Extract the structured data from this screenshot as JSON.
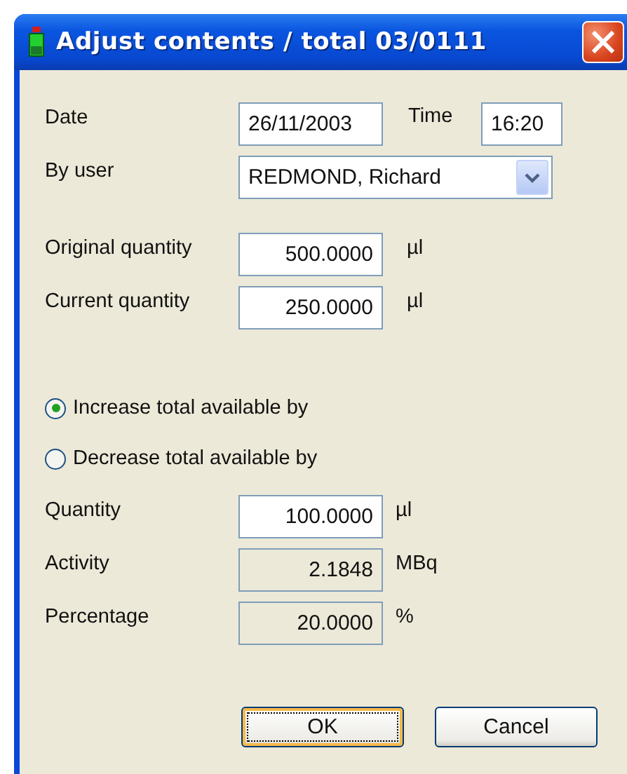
{
  "window": {
    "title": "Adjust contents / total 03/0111"
  },
  "date": {
    "label": "Date",
    "value": "26/11/2003"
  },
  "time": {
    "label": "Time",
    "value": "16:20"
  },
  "user": {
    "label": "By user",
    "value": "REDMOND, Richard"
  },
  "quantities": [
    {
      "label": "Original quantity",
      "value": "500.0000",
      "unit": "µl",
      "readonly": false
    },
    {
      "label": "Current quantity",
      "value": "250.0000",
      "unit": "µl",
      "readonly": false
    }
  ],
  "adjustment": [
    {
      "label": "Increase total available by",
      "selected": true
    },
    {
      "label": "Decrease total available by",
      "selected": false
    }
  ],
  "amounts": [
    {
      "label": "Quantity",
      "value": "100.0000",
      "unit": "µl",
      "readonly": false
    },
    {
      "label": "Activity",
      "value": "2.1848",
      "unit": "MBq",
      "readonly": true
    },
    {
      "label": "Percentage",
      "value": "20.0000",
      "unit": "%",
      "readonly": true
    }
  ],
  "buttons": [
    {
      "label": "OK",
      "default": true
    },
    {
      "label": "Cancel",
      "default": false
    }
  ]
}
